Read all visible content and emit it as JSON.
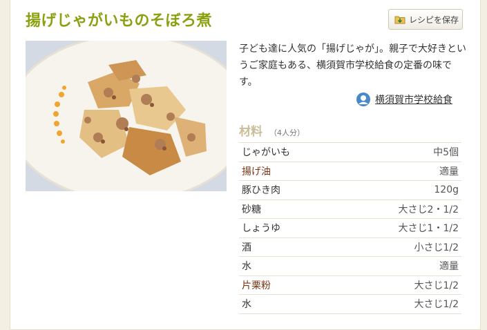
{
  "recipe": {
    "title": "揚げじゃがいものそぼろ煮",
    "save_button_label": "レシピを保存",
    "description": "子ども達に人気の「揚げじゃが」。親子で大好きというご家庭もある、横須賀市学校給食の定番の味です。",
    "author": "横須賀市学校給食",
    "ingredients_heading": "材料",
    "servings": "（4人分）",
    "ingredients": [
      {
        "name": "じゃがいも",
        "qty": "中5個",
        "linked": false
      },
      {
        "name": "揚げ油",
        "qty": "適量",
        "linked": true
      },
      {
        "name": "豚ひき肉",
        "qty": "120g",
        "linked": false
      },
      {
        "name": "砂糖",
        "qty": "大さじ2・1/2",
        "linked": false
      },
      {
        "name": "しょうゆ",
        "qty": "大さじ1・1/2",
        "linked": false
      },
      {
        "name": "酒",
        "qty": "小さじ1/2",
        "linked": false
      },
      {
        "name": "水",
        "qty": "適量",
        "linked": false
      },
      {
        "name": "片栗粉",
        "qty": "大さじ1/2",
        "linked": true
      },
      {
        "name": "水",
        "qty": "大さじ1/2",
        "linked": false
      }
    ]
  },
  "icons": {
    "save": "folder-save-icon",
    "author": "author-globe-icon"
  },
  "colors": {
    "title": "#8ba10f",
    "heading": "#cbbd9c",
    "linked_ingredient": "#7a3412"
  }
}
